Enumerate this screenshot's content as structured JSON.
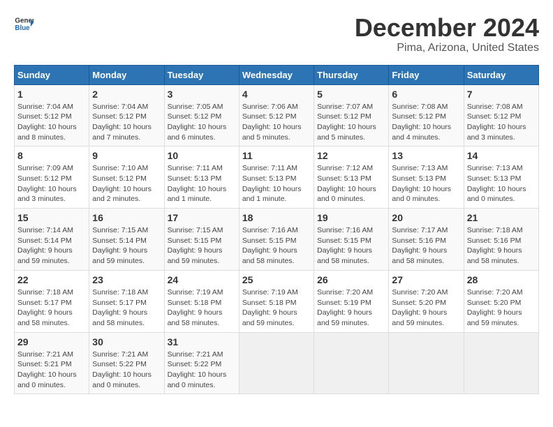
{
  "logo": {
    "text_general": "General",
    "text_blue": "Blue"
  },
  "title": "December 2024",
  "location": "Pima, Arizona, United States",
  "days_of_week": [
    "Sunday",
    "Monday",
    "Tuesday",
    "Wednesday",
    "Thursday",
    "Friday",
    "Saturday"
  ],
  "weeks": [
    [
      {
        "day": "1",
        "sunrise": "Sunrise: 7:04 AM",
        "sunset": "Sunset: 5:12 PM",
        "daylight": "Daylight: 10 hours and 8 minutes."
      },
      {
        "day": "2",
        "sunrise": "Sunrise: 7:04 AM",
        "sunset": "Sunset: 5:12 PM",
        "daylight": "Daylight: 10 hours and 7 minutes."
      },
      {
        "day": "3",
        "sunrise": "Sunrise: 7:05 AM",
        "sunset": "Sunset: 5:12 PM",
        "daylight": "Daylight: 10 hours and 6 minutes."
      },
      {
        "day": "4",
        "sunrise": "Sunrise: 7:06 AM",
        "sunset": "Sunset: 5:12 PM",
        "daylight": "Daylight: 10 hours and 5 minutes."
      },
      {
        "day": "5",
        "sunrise": "Sunrise: 7:07 AM",
        "sunset": "Sunset: 5:12 PM",
        "daylight": "Daylight: 10 hours and 5 minutes."
      },
      {
        "day": "6",
        "sunrise": "Sunrise: 7:08 AM",
        "sunset": "Sunset: 5:12 PM",
        "daylight": "Daylight: 10 hours and 4 minutes."
      },
      {
        "day": "7",
        "sunrise": "Sunrise: 7:08 AM",
        "sunset": "Sunset: 5:12 PM",
        "daylight": "Daylight: 10 hours and 3 minutes."
      }
    ],
    [
      {
        "day": "8",
        "sunrise": "Sunrise: 7:09 AM",
        "sunset": "Sunset: 5:12 PM",
        "daylight": "Daylight: 10 hours and 3 minutes."
      },
      {
        "day": "9",
        "sunrise": "Sunrise: 7:10 AM",
        "sunset": "Sunset: 5:12 PM",
        "daylight": "Daylight: 10 hours and 2 minutes."
      },
      {
        "day": "10",
        "sunrise": "Sunrise: 7:11 AM",
        "sunset": "Sunset: 5:13 PM",
        "daylight": "Daylight: 10 hours and 1 minute."
      },
      {
        "day": "11",
        "sunrise": "Sunrise: 7:11 AM",
        "sunset": "Sunset: 5:13 PM",
        "daylight": "Daylight: 10 hours and 1 minute."
      },
      {
        "day": "12",
        "sunrise": "Sunrise: 7:12 AM",
        "sunset": "Sunset: 5:13 PM",
        "daylight": "Daylight: 10 hours and 0 minutes."
      },
      {
        "day": "13",
        "sunrise": "Sunrise: 7:13 AM",
        "sunset": "Sunset: 5:13 PM",
        "daylight": "Daylight: 10 hours and 0 minutes."
      },
      {
        "day": "14",
        "sunrise": "Sunrise: 7:13 AM",
        "sunset": "Sunset: 5:13 PM",
        "daylight": "Daylight: 10 hours and 0 minutes."
      }
    ],
    [
      {
        "day": "15",
        "sunrise": "Sunrise: 7:14 AM",
        "sunset": "Sunset: 5:14 PM",
        "daylight": "Daylight: 9 hours and 59 minutes."
      },
      {
        "day": "16",
        "sunrise": "Sunrise: 7:15 AM",
        "sunset": "Sunset: 5:14 PM",
        "daylight": "Daylight: 9 hours and 59 minutes."
      },
      {
        "day": "17",
        "sunrise": "Sunrise: 7:15 AM",
        "sunset": "Sunset: 5:15 PM",
        "daylight": "Daylight: 9 hours and 59 minutes."
      },
      {
        "day": "18",
        "sunrise": "Sunrise: 7:16 AM",
        "sunset": "Sunset: 5:15 PM",
        "daylight": "Daylight: 9 hours and 58 minutes."
      },
      {
        "day": "19",
        "sunrise": "Sunrise: 7:16 AM",
        "sunset": "Sunset: 5:15 PM",
        "daylight": "Daylight: 9 hours and 58 minutes."
      },
      {
        "day": "20",
        "sunrise": "Sunrise: 7:17 AM",
        "sunset": "Sunset: 5:16 PM",
        "daylight": "Daylight: 9 hours and 58 minutes."
      },
      {
        "day": "21",
        "sunrise": "Sunrise: 7:18 AM",
        "sunset": "Sunset: 5:16 PM",
        "daylight": "Daylight: 9 hours and 58 minutes."
      }
    ],
    [
      {
        "day": "22",
        "sunrise": "Sunrise: 7:18 AM",
        "sunset": "Sunset: 5:17 PM",
        "daylight": "Daylight: 9 hours and 58 minutes."
      },
      {
        "day": "23",
        "sunrise": "Sunrise: 7:18 AM",
        "sunset": "Sunset: 5:17 PM",
        "daylight": "Daylight: 9 hours and 58 minutes."
      },
      {
        "day": "24",
        "sunrise": "Sunrise: 7:19 AM",
        "sunset": "Sunset: 5:18 PM",
        "daylight": "Daylight: 9 hours and 58 minutes."
      },
      {
        "day": "25",
        "sunrise": "Sunrise: 7:19 AM",
        "sunset": "Sunset: 5:18 PM",
        "daylight": "Daylight: 9 hours and 59 minutes."
      },
      {
        "day": "26",
        "sunrise": "Sunrise: 7:20 AM",
        "sunset": "Sunset: 5:19 PM",
        "daylight": "Daylight: 9 hours and 59 minutes."
      },
      {
        "day": "27",
        "sunrise": "Sunrise: 7:20 AM",
        "sunset": "Sunset: 5:20 PM",
        "daylight": "Daylight: 9 hours and 59 minutes."
      },
      {
        "day": "28",
        "sunrise": "Sunrise: 7:20 AM",
        "sunset": "Sunset: 5:20 PM",
        "daylight": "Daylight: 9 hours and 59 minutes."
      }
    ],
    [
      {
        "day": "29",
        "sunrise": "Sunrise: 7:21 AM",
        "sunset": "Sunset: 5:21 PM",
        "daylight": "Daylight: 10 hours and 0 minutes."
      },
      {
        "day": "30",
        "sunrise": "Sunrise: 7:21 AM",
        "sunset": "Sunset: 5:22 PM",
        "daylight": "Daylight: 10 hours and 0 minutes."
      },
      {
        "day": "31",
        "sunrise": "Sunrise: 7:21 AM",
        "sunset": "Sunset: 5:22 PM",
        "daylight": "Daylight: 10 hours and 0 minutes."
      },
      null,
      null,
      null,
      null
    ]
  ]
}
